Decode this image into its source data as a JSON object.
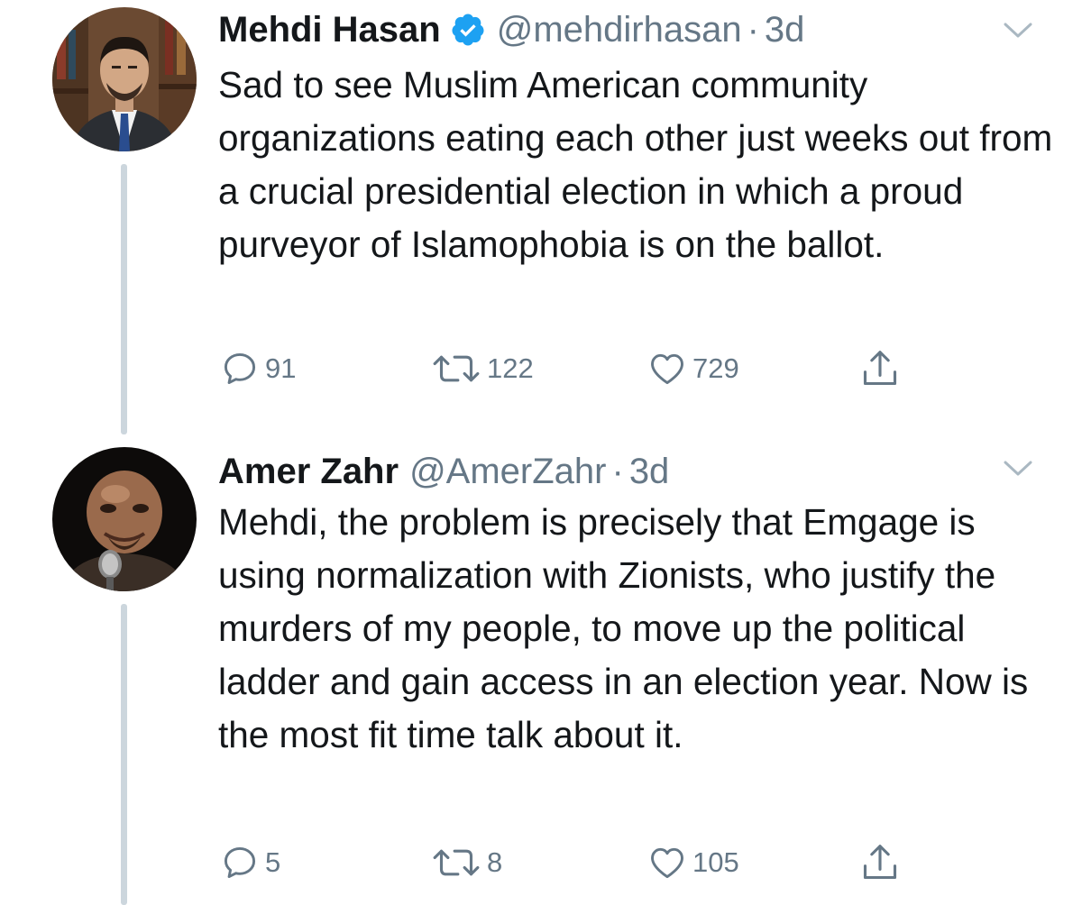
{
  "tweets": [
    {
      "name": "Mehdi Hasan",
      "verified": true,
      "handle": "@mehdirhasan",
      "separator": "·",
      "time": "3d",
      "text": "Sad to see Muslim American community organizations eating each other just weeks out from a crucial presidential election in which a proud purveyor of Islamophobia is on the ballot.",
      "replies": "91",
      "retweets": "122",
      "likes": "729"
    },
    {
      "name": "Amer Zahr",
      "verified": false,
      "handle": "@AmerZahr",
      "separator": "·",
      "time": "3d",
      "text": "Mehdi, the problem is precisely that Emgage is using normalization with Zionists, who justify the murders of my people, to move up the political ladder and gain access in an election year. Now is the most fit time talk about it.",
      "replies": "5",
      "retweets": "8",
      "likes": "105"
    }
  ],
  "icons": {
    "reply": "reply-icon",
    "retweet": "retweet-icon",
    "like": "heart-icon",
    "share": "share-icon",
    "caret": "chevron-down-icon",
    "verified": "verified-badge-icon"
  },
  "colors": {
    "text": "#14171a",
    "muted": "#657786",
    "verified": "#1da1f2",
    "thread_line": "#ccd6dd"
  }
}
